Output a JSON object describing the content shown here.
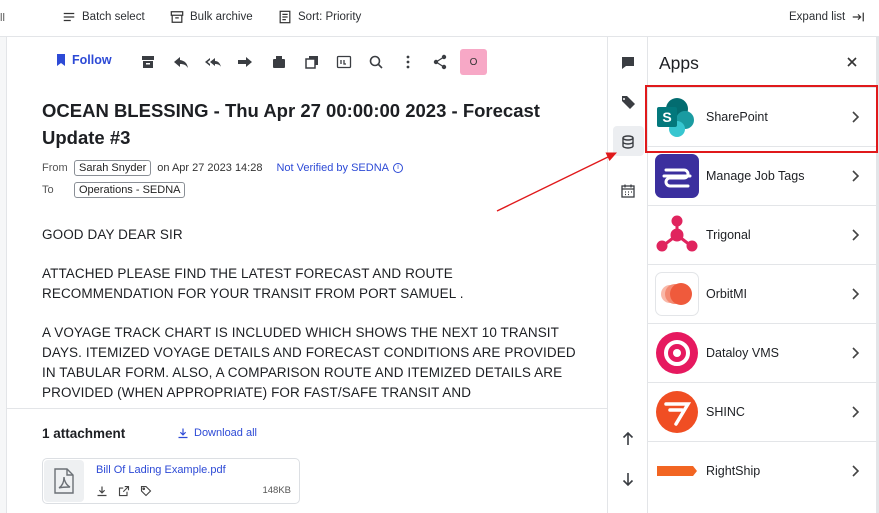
{
  "toolbar": {
    "batch_select": "Batch select",
    "bulk_archive": "Bulk archive",
    "sort": "Sort: Priority",
    "expand_list": "Expand list"
  },
  "message": {
    "follow_label": "Follow",
    "avatar_initial": "O",
    "subject": "OCEAN BLESSING - Thu Apr 27 00:00:00 2023 - Forecast Update #3",
    "from_label": "From",
    "from_name": "Sarah Snyder",
    "date": "on Apr 27 2023 14:28",
    "verification": "Not Verified by SEDNA",
    "to_label": "To",
    "to_name": "Operations - SEDNA",
    "body": [
      "GOOD DAY DEAR SIR",
      "ATTACHED PLEASE FIND THE LATEST FORECAST AND ROUTE RECOMMENDATION FOR YOUR TRANSIT FROM PORT SAMUEL .",
      "A VOYAGE TRACK CHART IS INCLUDED WHICH SHOWS THE NEXT 10 TRANSIT DAYS. ITEMIZED VOYAGE DETAILS AND FORECAST CONDITIONS ARE PROVIDED IN TABULAR FORM. ALSO, A COMPARISON ROUTE AND ITEMIZED DETAILS ARE PROVIDED (WHEN APPROPRIATE) FOR FAST/SAFE TRANSIT AND"
    ]
  },
  "attachments": {
    "title": "1 attachment",
    "download_all": "Download all",
    "file_name": "Bill Of Lading Example.pdf",
    "file_size": "148KB"
  },
  "apps": {
    "title": "Apps",
    "items": [
      {
        "name": "SharePoint",
        "icon": "sharepoint-logo",
        "color": "#0b7a75"
      },
      {
        "name": "Manage Job Tags",
        "icon": "job-tags-logo",
        "color": "#3b2f9e"
      },
      {
        "name": "Trigonal",
        "icon": "trigonal-logo",
        "color": "#e0245e"
      },
      {
        "name": "OrbitMI",
        "icon": "orbitmi-logo",
        "color": "#f06a4f"
      },
      {
        "name": "Dataloy VMS",
        "icon": "dataloy-logo",
        "color": "#e6195f"
      },
      {
        "name": "SHINC",
        "icon": "shinc-logo",
        "color": "#f04e23"
      },
      {
        "name": "RightShip",
        "icon": "rightship-logo",
        "color": "#f26522"
      }
    ]
  },
  "colors": {
    "accent": "#2d4ad6",
    "highlight": "#e0191b"
  }
}
